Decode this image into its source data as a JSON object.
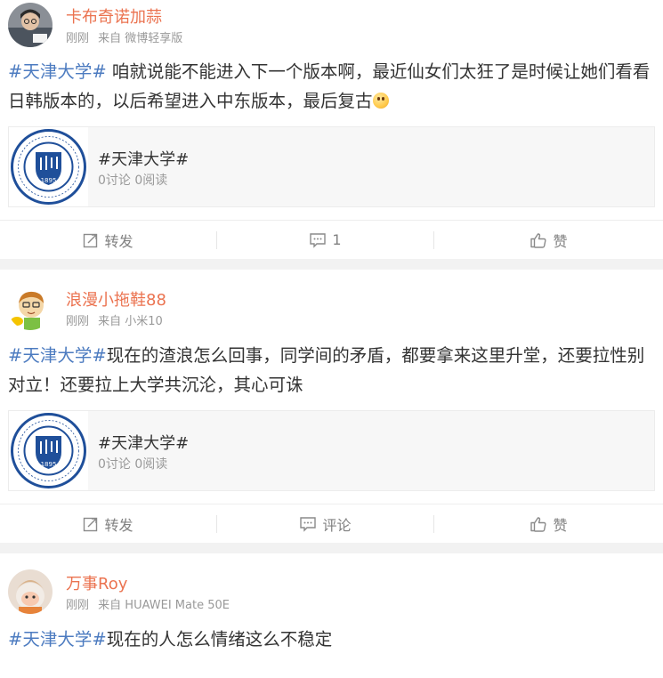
{
  "posts": [
    {
      "username": "卡布奇诺加蒜",
      "time": "刚刚",
      "source": "来自 微博轻享版",
      "topic": "#天津大学#",
      "text": " 咱就说能不能进入下一个版本啊，最近仙女们太狂了是时候让她们看看日韩版本的，以后希望进入中东版本，最后复古",
      "emoji": "surprised-emoji",
      "card": {
        "title": "#天津大学#",
        "stats": "0讨论 0阅读",
        "seal_year": "1895"
      },
      "actions": {
        "repost": "转发",
        "comment": "1",
        "like": "赞"
      }
    },
    {
      "username": "浪漫小拖鞋88",
      "time": "刚刚",
      "source": "来自 小米10",
      "topic": "#天津大学#",
      "text": "现在的渣浪怎么回事，同学间的矛盾，都要拿来这里升堂，还要拉性别对立！还要拉上大学共沉沦，其心可诛",
      "card": {
        "title": "#天津大学#",
        "stats": "0讨论 0阅读",
        "seal_year": "1895"
      },
      "actions": {
        "repost": "转发",
        "comment": "评论",
        "like": "赞"
      }
    },
    {
      "username": "万事Roy",
      "time": "刚刚",
      "source": "来自 HUAWEI Mate 50E",
      "topic": "#天津大学#",
      "text": "现在的人怎么情绪这么不稳定"
    }
  ],
  "colors": {
    "username": "#eb7350",
    "topic": "#4c7bc0",
    "meta": "#999999",
    "seal": "#1f4f9a"
  },
  "icons": {
    "repost": "repost-icon",
    "comment": "comment-icon",
    "like": "like-icon"
  }
}
